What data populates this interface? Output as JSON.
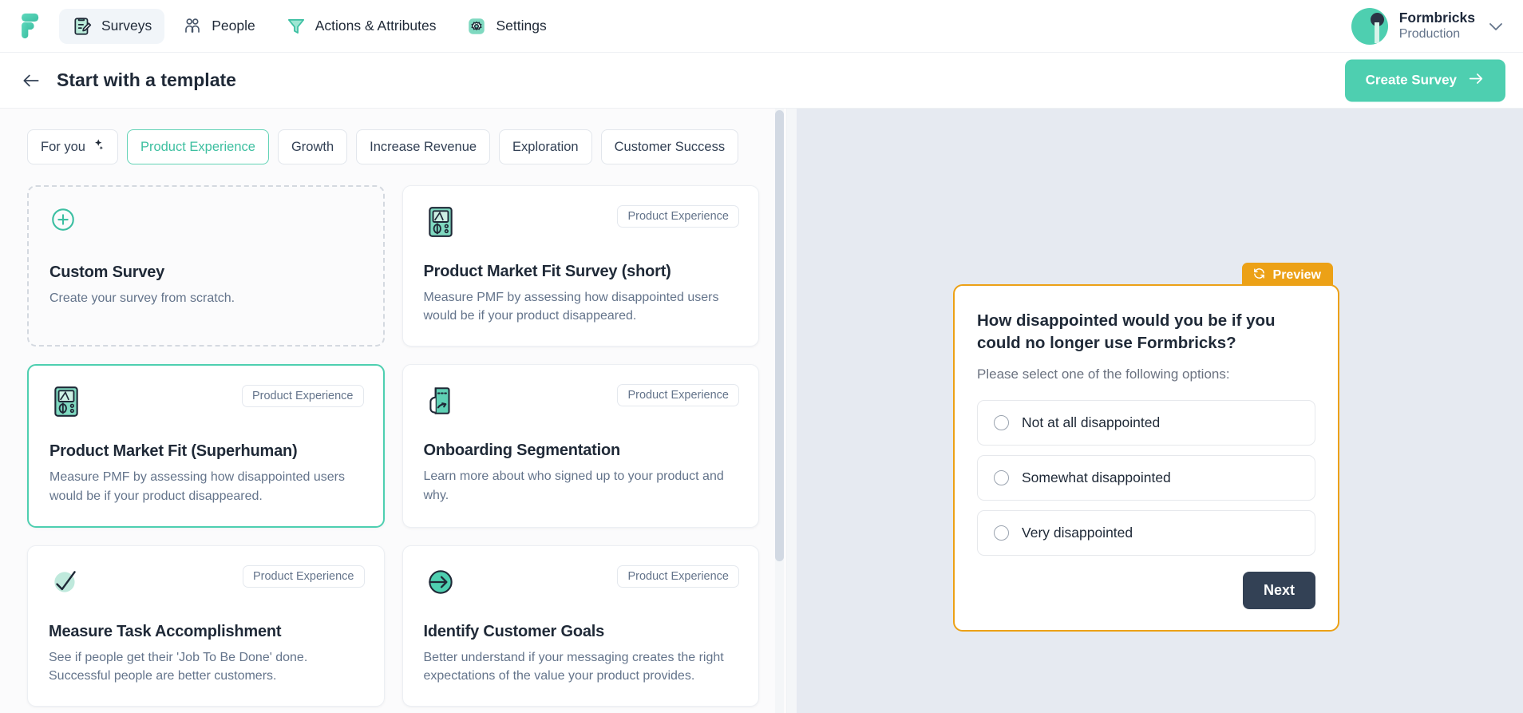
{
  "topnav": {
    "logo_icon": "formbricks-logo-icon",
    "items": [
      {
        "label": "Surveys",
        "icon": "clipboard-pencil-icon",
        "active": true
      },
      {
        "label": "People",
        "icon": "people-icon",
        "active": false
      },
      {
        "label": "Actions & Attributes",
        "icon": "funnel-icon",
        "active": false
      },
      {
        "label": "Settings",
        "icon": "gear-icon",
        "active": false
      }
    ],
    "account": {
      "name": "Formbricks",
      "environment": "Production",
      "chevron_icon": "chevron-down-icon",
      "avatar_icon": "avatar"
    }
  },
  "pagehead": {
    "back_icon": "arrow-left-icon",
    "title": "Start with a template",
    "create_label": "Create Survey",
    "create_icon": "arrow-right-icon"
  },
  "filters": [
    {
      "label": "For you",
      "icon": "sparkles-icon",
      "active": false
    },
    {
      "label": "Product Experience",
      "icon": "",
      "active": true
    },
    {
      "label": "Growth",
      "icon": "",
      "active": false
    },
    {
      "label": "Increase Revenue",
      "icon": "",
      "active": false
    },
    {
      "label": "Exploration",
      "icon": "",
      "active": false
    },
    {
      "label": "Customer Success",
      "icon": "",
      "active": false
    }
  ],
  "templates": [
    {
      "title": "Custom Survey",
      "description": "Create your survey from scratch.",
      "tag": "",
      "icon": "plus-circle-icon",
      "style": "dashed",
      "selected": false
    },
    {
      "title": "Product Market Fit Survey (short)",
      "description": "Measure PMF by assessing how disappointed users would be if your product disappeared.",
      "tag": "Product Experience",
      "icon": "multimeter-icon",
      "style": "plain",
      "selected": false
    },
    {
      "title": "Product Market Fit (Superhuman)",
      "description": "Measure PMF by assessing how disappointed users would be if your product disappeared.",
      "tag": "Product Experience",
      "icon": "multimeter-icon",
      "style": "plain",
      "selected": true
    },
    {
      "title": "Onboarding Segmentation",
      "description": "Learn more about who signed up to your product and why.",
      "tag": "Product Experience",
      "icon": "hand-tap-icon",
      "style": "plain",
      "selected": false
    },
    {
      "title": "Measure Task Accomplishment",
      "description": "See if people get their 'Job To Be Done' done. Successful people are better customers.",
      "tag": "Product Experience",
      "icon": "check-circle-icon",
      "style": "plain",
      "selected": false
    },
    {
      "title": "Identify Customer Goals",
      "description": "Better understand if your messaging creates the right expectations of the value your product provides.",
      "tag": "Product Experience",
      "icon": "arrow-right-circle-icon",
      "style": "plain",
      "selected": false
    }
  ],
  "preview": {
    "tab_label": "Preview",
    "tab_icon": "refresh-icon",
    "question": "How disappointed would you be if you could no longer use Formbricks?",
    "subtitle": "Please select one of the following options:",
    "options": [
      {
        "label": "Not at all disappointed",
        "selected": false
      },
      {
        "label": "Somewhat disappointed",
        "selected": false
      },
      {
        "label": "Very disappointed",
        "selected": false
      }
    ],
    "next_label": "Next"
  },
  "colors": {
    "accent": "#4ecfb0",
    "preview_border": "#eca116",
    "next_button": "#334155",
    "right_panel_bg": "#e6eaf1"
  }
}
